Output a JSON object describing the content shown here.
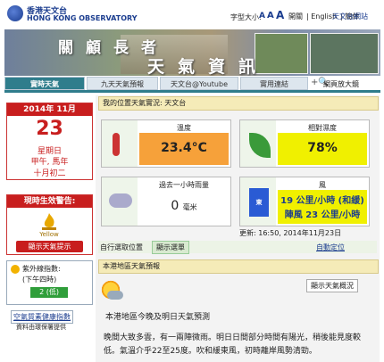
{
  "header": {
    "logo_cn": "香港天文台",
    "logo_en": "HONG KONG OBSERVATORY",
    "font_size_label": "字型大小:",
    "font_sizes": [
      "A",
      "A",
      "A"
    ],
    "links": [
      "開關",
      "English",
      "簡体"
    ],
    "observatory_link": "天文台網站"
  },
  "banner": {
    "line1": "關顧長者",
    "line2": "天氣資訊"
  },
  "tabs": [
    "實時天氣",
    "九天天氣預報",
    "天文台@Youtube",
    "實用連結"
  ],
  "zoom_label": "網頁放大鏡",
  "date": {
    "year_month": "2014年  11月",
    "day": "23",
    "weekday": "星期日",
    "lunar1": "甲午, 馬年",
    "lunar2": "十月初二"
  },
  "warnings": {
    "title": "現時生效警告:",
    "icon_label": "Yellow",
    "button": "顯示天氣提示"
  },
  "uv": {
    "title": "紫外線指數:",
    "subtitle": "(下午四時)",
    "value": "2 (低)"
  },
  "aqhi": {
    "link": "空氣質素健康指數",
    "note": "資料由環保署提供"
  },
  "location_bar": "我的位置天氣實況: 天文台",
  "temperature": {
    "title": "溫度",
    "value": "23.4°C"
  },
  "humidity": {
    "title": "相對濕度",
    "value": "78%"
  },
  "rainfall": {
    "title": "過去一小時雨量",
    "value": "0",
    "unit": "毫米"
  },
  "wind": {
    "title": "風",
    "direction": "東",
    "line1": "19 公里/小時 (和緩)",
    "line2": "陣風 23 公里/小時"
  },
  "updated": "更新: 16:50, 2014年11月23日",
  "select_location": {
    "label": "自行選取位置",
    "button": "顯示選單",
    "auto": "自動定位"
  },
  "forecast": {
    "title": "本港地區天氣預報",
    "summary_button": "顯示天氣概況",
    "heading": "本港地區今晚及明日天氣預測",
    "text1": "晚間大致多雲，有一兩陣微雨。明日日間部分時間有陽光，稍後能見度較",
    "text2": "低。氣溫介乎22至25度。吹和緩東風，初時離岸風勢清勁。"
  },
  "colors": {
    "accent": "#2f7d8c",
    "alert_red": "#c81e1e",
    "temp_orange": "#f6a13a",
    "humidity_yellow": "#f0f000"
  }
}
